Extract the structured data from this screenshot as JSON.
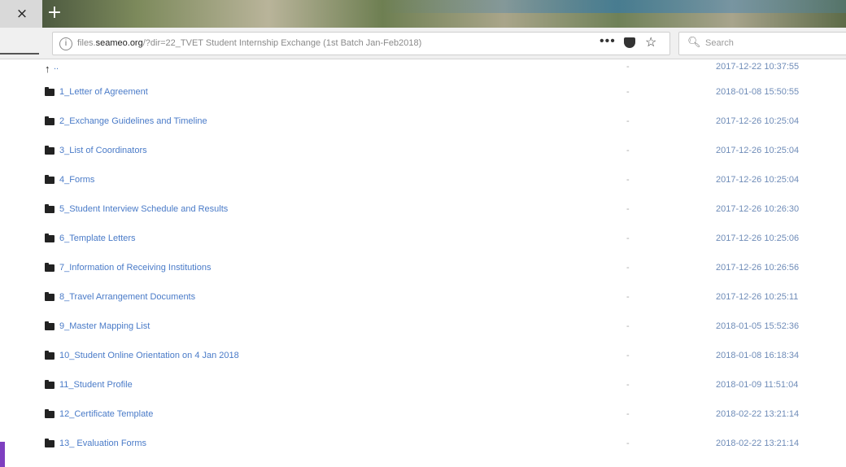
{
  "browser": {
    "close_glyph": "×",
    "newtab_glyph": "+",
    "url_domain": "files.seameo.org",
    "url_path": "/?dir=22_TVET Student Internship Exchange (1st Batch Jan-Feb2018)",
    "url_prefix": "files.",
    "url_domain_main": "seameo.org",
    "menu_dots": "•••",
    "search_placeholder": "Search"
  },
  "listing": {
    "parent": {
      "name": "..",
      "size": "-",
      "date": "2017-12-22 10:37:55"
    },
    "rows": [
      {
        "name": "1_Letter of Agreement",
        "size": "-",
        "date": "2018-01-08 15:50:55"
      },
      {
        "name": "2_Exchange Guidelines and Timeline",
        "size": "-",
        "date": "2017-12-26 10:25:04"
      },
      {
        "name": "3_List of Coordinators",
        "size": "-",
        "date": "2017-12-26 10:25:04"
      },
      {
        "name": "4_Forms",
        "size": "-",
        "date": "2017-12-26 10:25:04"
      },
      {
        "name": "5_Student Interview Schedule and Results",
        "size": "-",
        "date": "2017-12-26 10:26:30"
      },
      {
        "name": "6_Template Letters",
        "size": "-",
        "date": "2017-12-26 10:25:06"
      },
      {
        "name": "7_Information of Receiving Institutions",
        "size": "-",
        "date": "2017-12-26 10:26:56"
      },
      {
        "name": "8_Travel Arrangement Documents",
        "size": "-",
        "date": "2017-12-26 10:25:11"
      },
      {
        "name": "9_Master Mapping List",
        "size": "-",
        "date": "2018-01-05 15:52:36"
      },
      {
        "name": "10_Student Online Orientation on 4 Jan 2018",
        "size": "-",
        "date": "2018-01-08 16:18:34"
      },
      {
        "name": "11_Student Profile",
        "size": "-",
        "date": "2018-01-09 11:51:04"
      },
      {
        "name": "12_Certificate Template",
        "size": "-",
        "date": "2018-02-22 13:21:14"
      },
      {
        "name": "13_ Evaluation Forms",
        "size": "-",
        "date": "2018-02-22 13:21:14"
      }
    ]
  },
  "icons": {
    "folder": "folder-icon",
    "info": "info-icon",
    "pocket": "pocket-icon",
    "star": "bookmark-star-icon",
    "search": "search-icon",
    "parent": "parent-directory-icon"
  },
  "colors": {
    "link": "#4a7bc8",
    "date": "#6f8cb8",
    "size": "#a8a8a8",
    "accent": "#7e3fc0"
  }
}
